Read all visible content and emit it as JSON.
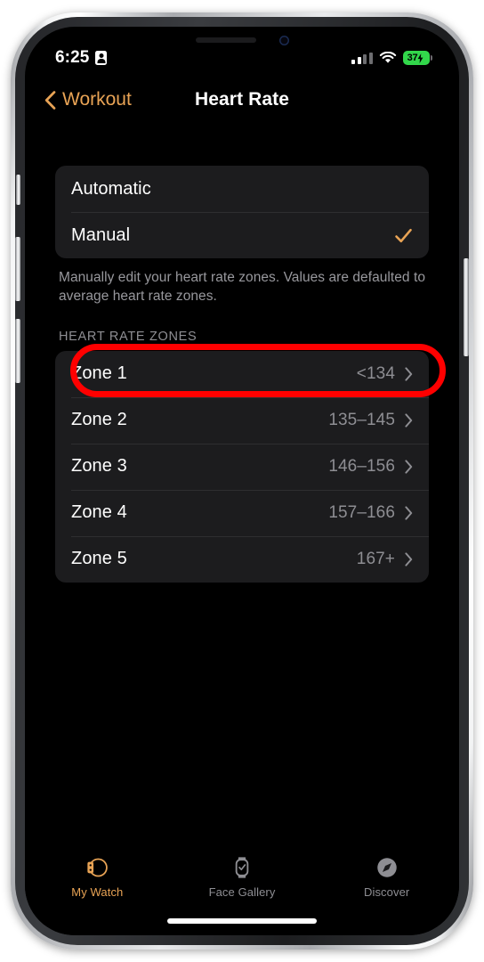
{
  "theme": {
    "accent": "#E8A355",
    "screen_bg": "#000000",
    "card_bg": "#1C1C1E",
    "secondary_text": "#8E8E93",
    "annotation_color": "#FF0000",
    "battery_color": "#32D74B"
  },
  "status_bar": {
    "time": "6:25",
    "badge_icon": "person-badge-icon",
    "signal_icon": "cellular-signal-icon",
    "wifi_icon": "wifi-icon",
    "battery_percent": "37",
    "battery_icon": "battery-charging-icon"
  },
  "nav_bar": {
    "back_icon": "chevron-left-icon",
    "back_label": "Workout",
    "title": "Heart Rate"
  },
  "mode_section": {
    "rows": [
      {
        "label": "Automatic",
        "checked": false
      },
      {
        "label": "Manual",
        "checked": true
      }
    ],
    "check_icon": "checkmark-icon",
    "footnote": "Manually edit your heart rate zones. Values are defaulted to average heart rate zones."
  },
  "zones_section": {
    "header": "HEART RATE ZONES",
    "chevron_icon": "chevron-right-icon",
    "rows": [
      {
        "label": "Zone 1",
        "value": "<134",
        "highlighted": true
      },
      {
        "label": "Zone 2",
        "value": "135–145",
        "highlighted": false
      },
      {
        "label": "Zone 3",
        "value": "146–156",
        "highlighted": false
      },
      {
        "label": "Zone 4",
        "value": "157–166",
        "highlighted": false
      },
      {
        "label": "Zone 5",
        "value": "167+",
        "highlighted": false
      }
    ]
  },
  "tab_bar": {
    "tabs": [
      {
        "label": "My Watch",
        "icon": "apple-watch-side-icon",
        "active": true
      },
      {
        "label": "Face Gallery",
        "icon": "watch-face-icon",
        "active": false
      },
      {
        "label": "Discover",
        "icon": "compass-icon",
        "active": false
      }
    ]
  }
}
